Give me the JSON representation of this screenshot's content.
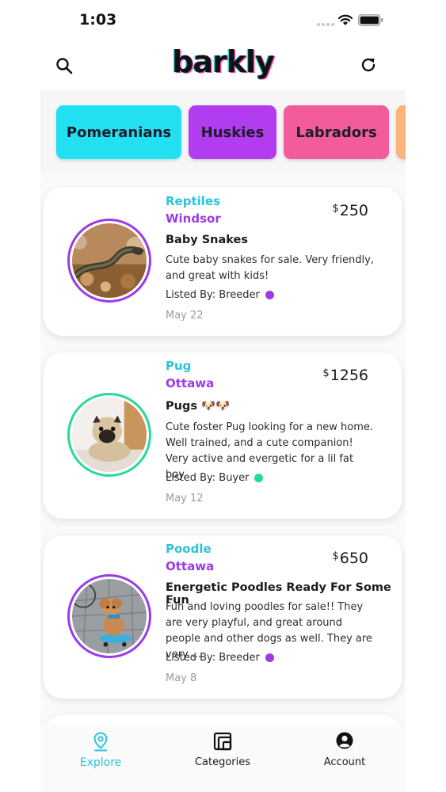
{
  "status_bar": {
    "time": "1:03"
  },
  "header": {
    "logo": "barkly",
    "search_icon": "search-icon",
    "refresh_icon": "refresh-icon"
  },
  "breeds": [
    {
      "label": "Pomeranians",
      "color": "#22e0f2"
    },
    {
      "label": "Huskies",
      "color": "#b13cf0"
    },
    {
      "label": "Labradors",
      "color": "#f25b9c"
    },
    {
      "label": "",
      "color": "#f8b47a"
    }
  ],
  "listings": [
    {
      "category": "Reptiles",
      "city": "Windsor",
      "currency": "$",
      "price": "250",
      "title": "Baby Snakes",
      "description": "Cute baby snakes for sale. Very friendly, and great with kids!",
      "listed_by": "Listed By: Breeder",
      "date": "May 22",
      "ring_color": "#9b3be6",
      "dot_color": "#9b3be6",
      "image": "snake-photo"
    },
    {
      "category": "Pug",
      "city": "Ottawa",
      "currency": "$",
      "price": "1256",
      "title": "Pugs 🐶🐶",
      "description": "Cute foster Pug looking for a new home. Well trained, and a cute companion! Very active and evergetic for a lil fat boy.",
      "listed_by": "Listed By: Buyer",
      "date": "May 12",
      "ring_color": "#27d99a",
      "dot_color": "#27d99a",
      "image": "pug-photo"
    },
    {
      "category": "Poodle",
      "city": "Ottawa",
      "currency": "$",
      "price": "650",
      "title": "Energetic Poodles Ready For Some Fun",
      "description": "Fun and loving poodles for sale!! They are very playful, and great around people and other dogs as well. They are very ...",
      "listed_by": "Listed By: Breeder",
      "date": "May 8",
      "ring_color": "#9b3be6",
      "dot_color": "#9b3be6",
      "image": "poodle-photo"
    }
  ],
  "tabs": [
    {
      "label": "Explore",
      "icon": "location-pin-icon",
      "active": true
    },
    {
      "label": "Categories",
      "icon": "categories-icon",
      "active": false
    },
    {
      "label": "Account",
      "icon": "account-icon",
      "active": false
    }
  ],
  "colors": {
    "accent_cyan": "#2bc4d9",
    "accent_purple": "#9b3be6"
  }
}
